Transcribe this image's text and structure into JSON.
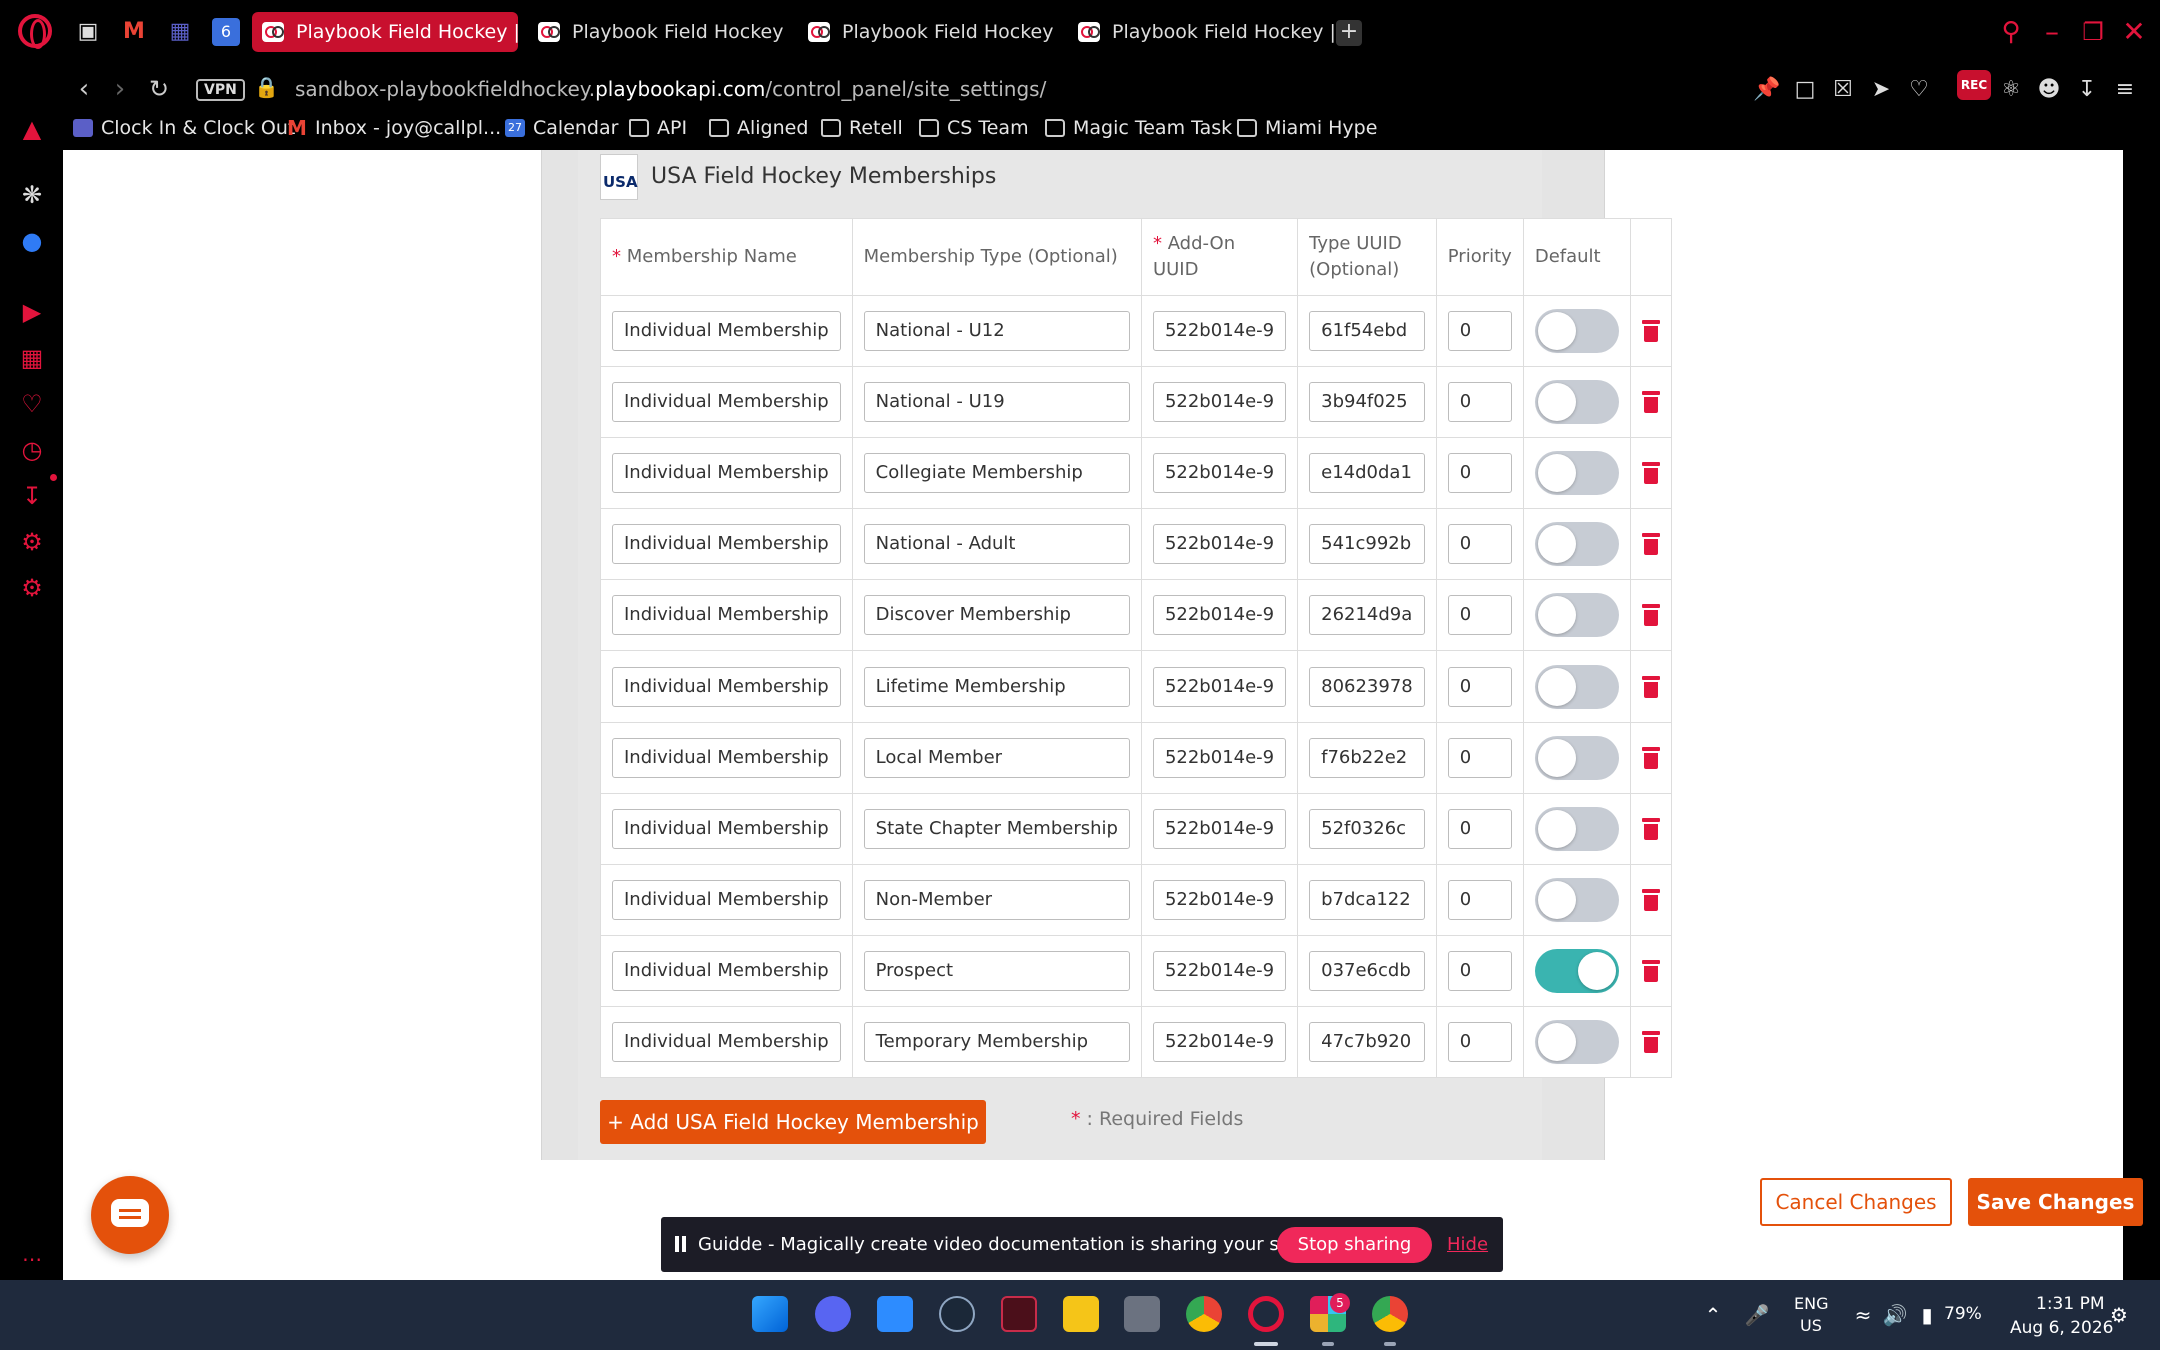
{
  "browser": {
    "tabs": [
      {
        "label": "Playbook Field Hockey | Pla",
        "active": true
      },
      {
        "label": "Playbook Field Hockey | Pl",
        "active": false
      },
      {
        "label": "Playbook Field Hockey | Pl",
        "active": false
      },
      {
        "label": "Playbook Field Hockey | Pla",
        "active": false
      }
    ],
    "tab_badge_count": "6",
    "vpn_label": "VPN",
    "url_prefix": "sandbox-playbookfieldhockey.",
    "url_host": "playbookapi.com",
    "url_path": "/control_panel/site_settings/",
    "rec_label": "REC"
  },
  "bookmarks": [
    {
      "label": "Clock In & Clock Out",
      "icon": "clock-app-icon"
    },
    {
      "label": "Inbox - joy@callpl...",
      "icon": "gmail-icon"
    },
    {
      "label": "Calendar",
      "icon": "calendar-icon",
      "badge": "27"
    },
    {
      "label": "API",
      "icon": "folder-icon"
    },
    {
      "label": "Aligned",
      "icon": "folder-icon"
    },
    {
      "label": "Retell",
      "icon": "folder-icon"
    },
    {
      "label": "CS Team",
      "icon": "folder-icon"
    },
    {
      "label": "Magic Team Task",
      "icon": "folder-icon"
    },
    {
      "label": "Miami Hype",
      "icon": "folder-icon"
    }
  ],
  "sidebar": {
    "gx_label": "GX"
  },
  "card": {
    "logo_text": "USA",
    "title": "USA Field Hockey Memberships",
    "columns": {
      "name": "Membership Name",
      "type": "Membership Type (Optional)",
      "addon": "Add-On UUID",
      "type_uuid": "Type UUID (Optional)",
      "priority": "Priority",
      "default": "Default"
    },
    "rows": [
      {
        "name": "Individual Membership",
        "type": "National - U12",
        "addon": "522b014e-9",
        "type_uuid": "61f54ebd",
        "priority": "0",
        "default": false
      },
      {
        "name": "Individual Membership",
        "type": "National - U19",
        "addon": "522b014e-9",
        "type_uuid": "3b94f025",
        "priority": "0",
        "default": false
      },
      {
        "name": "Individual Membership",
        "type": "Collegiate Membership",
        "addon": "522b014e-9",
        "type_uuid": "e14d0da1",
        "priority": "0",
        "default": false
      },
      {
        "name": "Individual Membership",
        "type": "National - Adult",
        "addon": "522b014e-9",
        "type_uuid": "541c992b",
        "priority": "0",
        "default": false
      },
      {
        "name": "Individual Membership",
        "type": "Discover Membership",
        "addon": "522b014e-9",
        "type_uuid": "26214d9a",
        "priority": "0",
        "default": false
      },
      {
        "name": "Individual Membership",
        "type": "Lifetime Membership",
        "addon": "522b014e-9",
        "type_uuid": "80623978",
        "priority": "0",
        "default": false
      },
      {
        "name": "Individual Membership",
        "type": "Local Member",
        "addon": "522b014e-9",
        "type_uuid": "f76b22e2",
        "priority": "0",
        "default": false
      },
      {
        "name": "Individual Membership",
        "type": "State Chapter Membership",
        "addon": "522b014e-9",
        "type_uuid": "52f0326c",
        "priority": "0",
        "default": false
      },
      {
        "name": "Individual Membership",
        "type": "Non-Member",
        "addon": "522b014e-9",
        "type_uuid": "b7dca122",
        "priority": "0",
        "default": false
      },
      {
        "name": "Individual Membership",
        "type": "Prospect",
        "addon": "522b014e-9",
        "type_uuid": "037e6cdb",
        "priority": "0",
        "default": true
      },
      {
        "name": "Individual Membership",
        "type": "Temporary Membership",
        "addon": "522b014e-9",
        "type_uuid": "47c7b920",
        "priority": "0",
        "default": false
      }
    ],
    "add_button": "+ Add USA Field Hockey Membership",
    "required_note": ": Required Fields",
    "required_mark": "*"
  },
  "actions": {
    "cancel": "Cancel Changes",
    "save": "Save Changes"
  },
  "guidde": {
    "message": "Guidde - Magically create video documentation is sharing your screen.",
    "stop": "Stop sharing",
    "hide": "Hide"
  },
  "taskbar": {
    "slack_badge": "5",
    "lang_top": "ENG",
    "lang_bottom": "US",
    "battery": "79%",
    "time": "1:31 PM",
    "date": "Aug 6, 2026"
  },
  "colors": {
    "accent": "#e4510b",
    "opera_red": "#e2143c",
    "toggle_on": "#3ab4b0",
    "toggle_off": "#c7ccd4"
  }
}
